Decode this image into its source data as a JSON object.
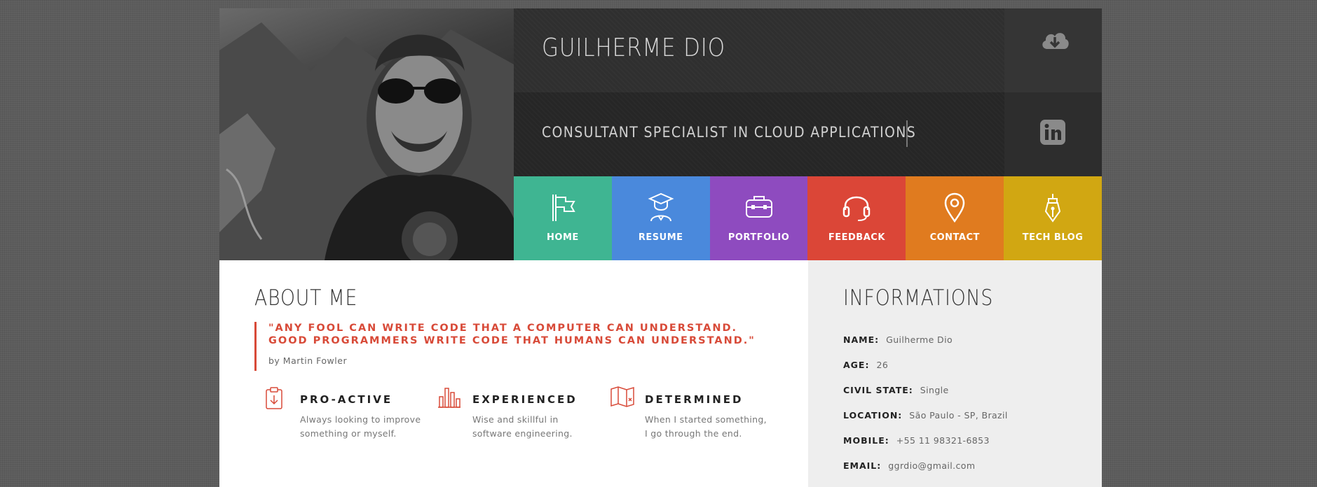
{
  "header": {
    "name": "GUILHERME DIO",
    "title": "CONSULTANT SPECIALIST IN CLOUD APPLICATIONS",
    "icons": [
      "cloud-download-icon",
      "linkedin-icon"
    ]
  },
  "nav": [
    {
      "label": "HOME",
      "icon": "flag-icon",
      "color": "#3fb592"
    },
    {
      "label": "RESUME",
      "icon": "graduate-icon",
      "color": "#4a89dc"
    },
    {
      "label": "PORTFOLIO",
      "icon": "briefcase-icon",
      "color": "#8e4bbf"
    },
    {
      "label": "FEEDBACK",
      "icon": "headset-icon",
      "color": "#db4637"
    },
    {
      "label": "CONTACT",
      "icon": "map-pin-icon",
      "color": "#e07b1f"
    },
    {
      "label": "TECH BLOG",
      "icon": "pen-nib-icon",
      "color": "#d1a712"
    }
  ],
  "about": {
    "heading": "ABOUT ME",
    "quote_line1": "\"ANY FOOL CAN WRITE CODE THAT A COMPUTER CAN UNDERSTAND.",
    "quote_line2": "GOOD PROGRAMMERS WRITE CODE THAT HUMANS CAN UNDERSTAND.\"",
    "author": "by Martin Fowler",
    "features": [
      {
        "title": "PRO-ACTIVE",
        "line1": "Always looking to improve",
        "line2": "something or myself.",
        "icon": "clipboard-down-icon"
      },
      {
        "title": "EXPERIENCED",
        "line1": "Wise and skillful in",
        "line2": "software engineering.",
        "icon": "bar-chart-icon"
      },
      {
        "title": "DETERMINED",
        "line1": "When I started something,",
        "line2": "I go through the end.",
        "icon": "map-icon"
      }
    ]
  },
  "info": {
    "heading": "INFORMATIONS",
    "rows": [
      {
        "key": "NAME:",
        "value": "Guilherme Dio"
      },
      {
        "key": "AGE:",
        "value": "26"
      },
      {
        "key": "CIVIL STATE:",
        "value": "Single"
      },
      {
        "key": "LOCATION:",
        "value": "São Paulo - SP, Brazil"
      },
      {
        "key": "MOBILE:",
        "value": "+55 11 98321-6853"
      },
      {
        "key": "EMAIL:",
        "value": "ggrdio@gmail.com"
      }
    ]
  },
  "colors": {
    "accent": "#d84a38",
    "dark": "#2f2f2f",
    "info_bg": "#eeeeee"
  }
}
